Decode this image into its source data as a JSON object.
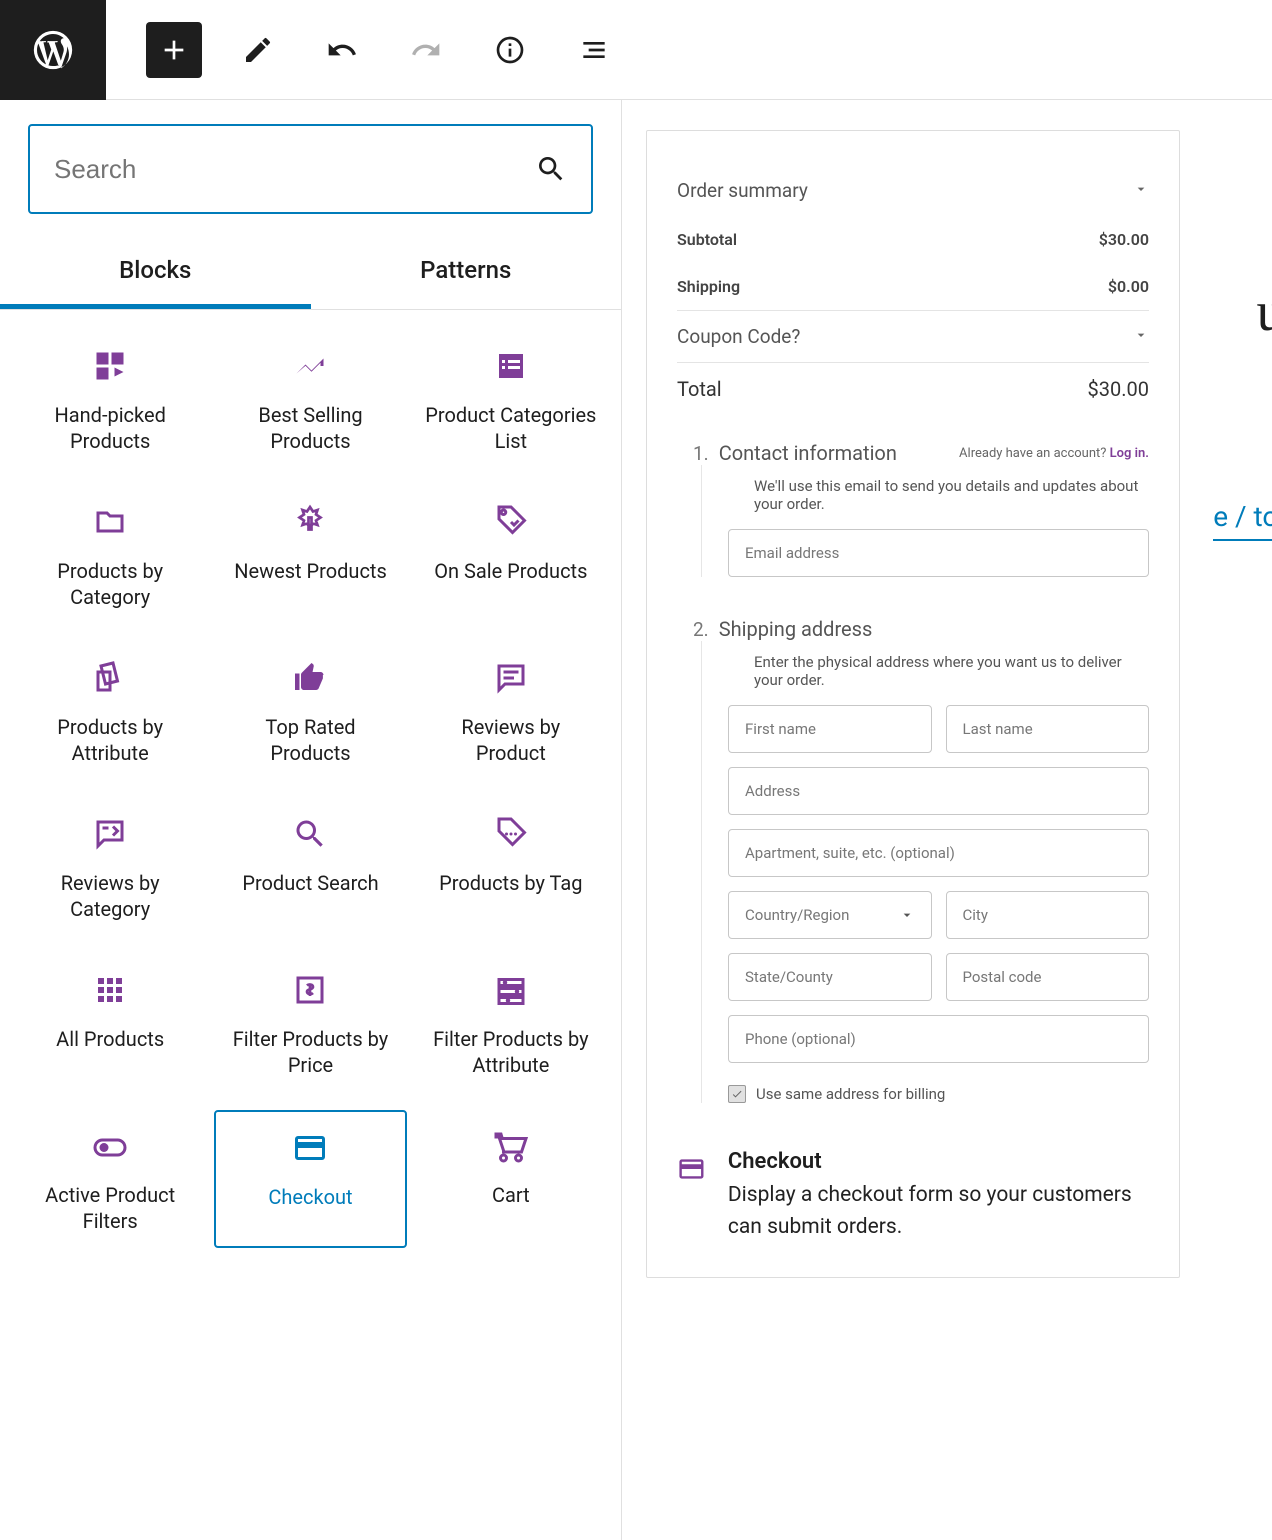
{
  "topbar": {},
  "search": {
    "placeholder": "Search"
  },
  "tabs": {
    "blocks": "Blocks",
    "patterns": "Patterns"
  },
  "blocks": [
    {
      "label": "Hand-picked Products",
      "icon": "grid"
    },
    {
      "label": "Best Selling Products",
      "icon": "trend"
    },
    {
      "label": "Product Categories List",
      "icon": "list"
    },
    {
      "label": "Products by Category",
      "icon": "folder"
    },
    {
      "label": "Newest Products",
      "icon": "burst"
    },
    {
      "label": "On Sale Products",
      "icon": "tag"
    },
    {
      "label": "Products by Attribute",
      "icon": "cards"
    },
    {
      "label": "Top Rated Products",
      "icon": "thumb"
    },
    {
      "label": "Reviews by Product",
      "icon": "review"
    },
    {
      "label": "Reviews by Category",
      "icon": "reviewcat"
    },
    {
      "label": "Product Search",
      "icon": "search"
    },
    {
      "label": "Products by Tag",
      "icon": "tagmore"
    },
    {
      "label": "All Products",
      "icon": "allgrid"
    },
    {
      "label": "Filter Products by Price",
      "icon": "price"
    },
    {
      "label": "Filter Products by Attribute",
      "icon": "filterattr"
    },
    {
      "label": "Active Product Filters",
      "icon": "toggle"
    },
    {
      "label": "Checkout",
      "icon": "card",
      "selected": true
    },
    {
      "label": "Cart",
      "icon": "cart"
    }
  ],
  "summary": {
    "title": "Order summary",
    "subtotal_label": "Subtotal",
    "subtotal": "$30.00",
    "shipping_label": "Shipping",
    "shipping": "$0.00",
    "coupon": "Coupon Code?",
    "total_label": "Total",
    "total": "$30.00"
  },
  "step1": {
    "num": "1.",
    "title": "Contact information",
    "login_pre": "Already have an account? ",
    "login_link": "Log in.",
    "desc": "We'll use this email to send you details and updates about your order.",
    "email_ph": "Email address"
  },
  "step2": {
    "num": "2.",
    "title": "Shipping address",
    "desc": "Enter the physical address where you want us to deliver your order.",
    "first": "First name",
    "last": "Last name",
    "address": "Address",
    "apt": "Apartment, suite, etc. (optional)",
    "country": "Country/Region",
    "city": "City",
    "state": "State/County",
    "postal": "Postal code",
    "phone": "Phone (optional)",
    "same": "Use same address for billing"
  },
  "desc_block": {
    "title": "Checkout",
    "text": "Display a checkout form so your customers can submit orders."
  },
  "bg": {
    "t1": "ut",
    "t2": "e / to c"
  }
}
